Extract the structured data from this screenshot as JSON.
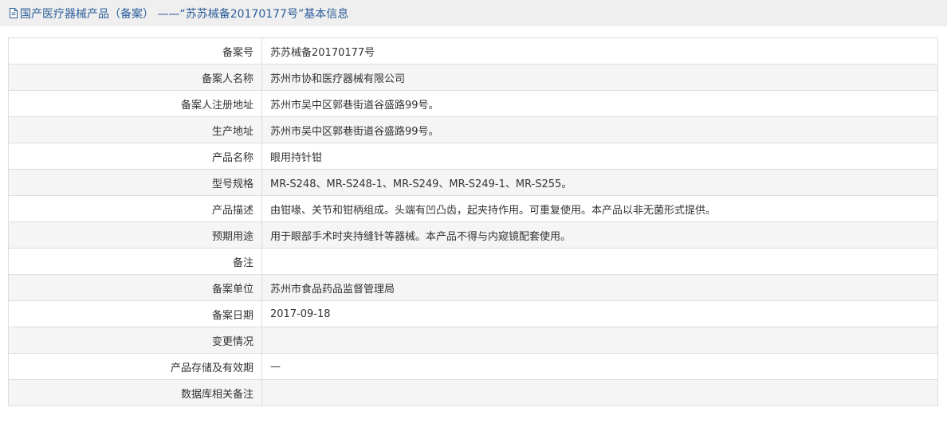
{
  "header": {
    "title": "国产医疗器械产品（备案） ——“苏苏械备20170177号”基本信息"
  },
  "rows": [
    {
      "label": "备案号",
      "value": "苏苏械备20170177号"
    },
    {
      "label": "备案人名称",
      "value": "苏州市协和医疗器械有限公司"
    },
    {
      "label": "备案人注册地址",
      "value": "苏州市吴中区郭巷街道谷盛路99号。"
    },
    {
      "label": "生产地址",
      "value": "苏州市吴中区郭巷街道谷盛路99号。"
    },
    {
      "label": "产品名称",
      "value": "眼用持针钳"
    },
    {
      "label": "型号规格",
      "value": "MR-S248、MR-S248-1、MR-S249、MR-S249-1、MR-S255。"
    },
    {
      "label": "产品描述",
      "value": "由钳喙、关节和钳柄组成。头端有凹凸齿，起夹持作用。可重复使用。本产品以非无菌形式提供。"
    },
    {
      "label": "预期用途",
      "value": "用于眼部手术时夹持缝针等器械。本产品不得与内窥镜配套使用。"
    },
    {
      "label": "备注",
      "value": ""
    },
    {
      "label": "备案单位",
      "value": "苏州市食品药品监督管理局"
    },
    {
      "label": "备案日期",
      "value": "2017-09-18"
    },
    {
      "label": "变更情况",
      "value": ""
    },
    {
      "label": "产品存储及有效期",
      "value": "—"
    },
    {
      "label": "数据库相关备注",
      "value": ""
    }
  ]
}
